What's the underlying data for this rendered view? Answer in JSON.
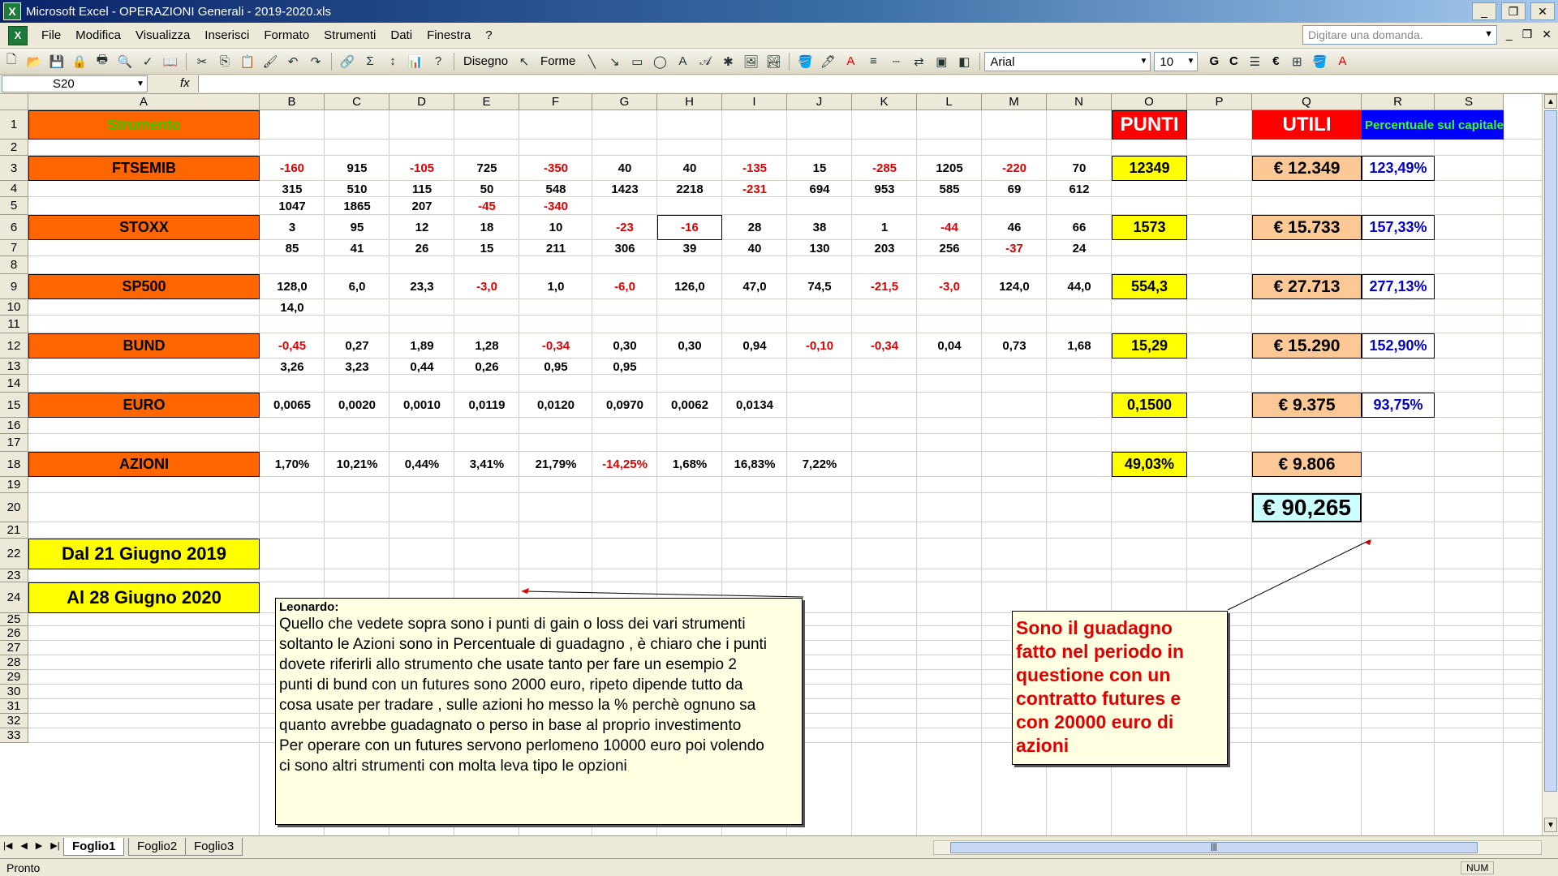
{
  "window": {
    "title": "Microsoft Excel - OPERAZIONI Generali - 2019-2020.xls"
  },
  "menu": {
    "items": [
      "File",
      "Modifica",
      "Visualizza",
      "Inserisci",
      "Formato",
      "Strumenti",
      "Dati",
      "Finestra",
      "?"
    ],
    "help_placeholder": "Digitare una domanda."
  },
  "toolbar": {
    "draw_label": "Disegno",
    "shapes_label": "Forme",
    "font_name": "Arial",
    "font_size": "10",
    "bold_label": "G",
    "italic_label": "C",
    "currency_label": "€"
  },
  "formula_bar": {
    "name_box": "S20",
    "fx": "fx",
    "content": ""
  },
  "columns": [
    "A",
    "B",
    "C",
    "D",
    "E",
    "F",
    "G",
    "H",
    "I",
    "J",
    "K",
    "L",
    "M",
    "N",
    "O",
    "P",
    "Q",
    "R",
    "S"
  ],
  "rows": [
    "1",
    "2",
    "3",
    "4",
    "5",
    "6",
    "7",
    "8",
    "9",
    "10",
    "11",
    "12",
    "13",
    "14",
    "15",
    "16",
    "17",
    "18",
    "19",
    "20",
    "21",
    "22",
    "23",
    "24",
    "25",
    "26",
    "27",
    "28",
    "29",
    "30",
    "31",
    "32",
    "33"
  ],
  "headers": {
    "strumento": "Strumento",
    "punti": "PUNTI",
    "utili": "UTILI",
    "percentuale": "Percentuale sul capitale"
  },
  "instruments": [
    {
      "name": "FTSEMIB",
      "punti": "12349",
      "utili": "€ 12.349",
      "percentuale": "123,49%"
    },
    {
      "name": "STOXX",
      "punti": "1573",
      "utili": "€ 15.733",
      "percentuale": "157,33%"
    },
    {
      "name": "SP500",
      "punti": "554,3",
      "utili": "€ 27.713",
      "percentuale": "277,13%"
    },
    {
      "name": "BUND",
      "punti": "15,29",
      "utili": "€ 15.290",
      "percentuale": "152,90%"
    },
    {
      "name": "EURO",
      "punti": "0,1500",
      "utili": "€ 9.375",
      "percentuale": "93,75%"
    },
    {
      "name": "AZIONI",
      "punti": "49,03%",
      "utili": "€ 9.806",
      "percentuale": ""
    }
  ],
  "data_rows": [
    {
      "row": "3",
      "values": [
        "-160",
        "915",
        "-105",
        "725",
        "-350",
        "40",
        "40",
        "-135",
        "15",
        "-285",
        "1205",
        "-220",
        "70"
      ]
    },
    {
      "row": "4",
      "values": [
        "315",
        "510",
        "115",
        "50",
        "548",
        "1423",
        "2218",
        "-231",
        "694",
        "953",
        "585",
        "69",
        "612"
      ]
    },
    {
      "row": "5",
      "values": [
        "1047",
        "1865",
        "207",
        "-45",
        "-340",
        "",
        "",
        "",
        "",
        "",
        "",
        "",
        ""
      ]
    },
    {
      "row": "6",
      "values": [
        "3",
        "95",
        "12",
        "18",
        "10",
        "-23",
        "-16",
        "28",
        "38",
        "1",
        "-44",
        "46",
        "66"
      ]
    },
    {
      "row": "7",
      "values": [
        "85",
        "41",
        "26",
        "15",
        "211",
        "306",
        "39",
        "40",
        "130",
        "203",
        "256",
        "-37",
        "24"
      ]
    },
    {
      "row": "9",
      "values": [
        "128,0",
        "6,0",
        "23,3",
        "-3,0",
        "1,0",
        "-6,0",
        "126,0",
        "47,0",
        "74,5",
        "-21,5",
        "-3,0",
        "124,0",
        "44,0"
      ]
    },
    {
      "row": "10",
      "values": [
        "14,0",
        "",
        "",
        "",
        "",
        "",
        "",
        "",
        "",
        "",
        "",
        "",
        ""
      ]
    },
    {
      "row": "12",
      "values": [
        "-0,45",
        "0,27",
        "1,89",
        "1,28",
        "-0,34",
        "0,30",
        "0,30",
        "0,94",
        "-0,10",
        "-0,34",
        "0,04",
        "0,73",
        "1,68"
      ]
    },
    {
      "row": "13",
      "values": [
        "3,26",
        "3,23",
        "0,44",
        "0,26",
        "0,95",
        "0,95",
        "",
        "",
        "",
        "",
        "",
        "",
        ""
      ]
    },
    {
      "row": "15",
      "values": [
        "0,0065",
        "0,0020",
        "0,0010",
        "0,0119",
        "0,0120",
        "0,0970",
        "0,0062",
        "0,0134",
        "",
        "",
        "",
        "",
        ""
      ]
    },
    {
      "row": "18",
      "values": [
        "1,70%",
        "10,21%",
        "0,44%",
        "3,41%",
        "21,79%",
        "-14,25%",
        "1,68%",
        "16,83%",
        "7,22%",
        "",
        "",
        "",
        ""
      ]
    }
  ],
  "total": "€ 90,265",
  "dates": {
    "from": "Dal 21 Giugno  2019",
    "to": "Al 28 Giugno 2020"
  },
  "comment_main": {
    "author": "Leonardo:",
    "lines": [
      "Quello che vedete sopra sono i punti di gain o loss dei vari strumenti",
      "soltanto le Azioni sono in Percentuale di guadagno , è chiaro che i punti",
      "dovete riferirli allo strumento che usate tanto per fare un esempio 2",
      "punti di bund con un futures sono 2000 euro, ripeto dipende tutto da",
      "cosa usate per tradare , sulle azioni ho messo la % perchè ognuno sa",
      "quanto avrebbe guadagnato o perso in base al proprio investimento",
      "Per operare con un futures servono perlomeno 10000 euro poi volendo",
      "ci sono altri strumenti con molta leva tipo le opzioni"
    ]
  },
  "comment_total": {
    "lines": [
      "Sono il guadagno",
      "fatto nel periodo in",
      "questione con un",
      "contratto futures e",
      "con 20000 euro di",
      "azioni"
    ]
  },
  "sheets": [
    "Foglio1",
    "Foglio2",
    "Foglio3"
  ],
  "status": {
    "left": "Pronto",
    "num": "NUM"
  },
  "colors": {
    "orange": "#ff6600",
    "yellow": "#ffff00",
    "peach": "#fcc896",
    "red_header": "#ff0000",
    "blue_header": "#0000ff",
    "negative": "#e00000",
    "total_bg": "#ccffff"
  }
}
